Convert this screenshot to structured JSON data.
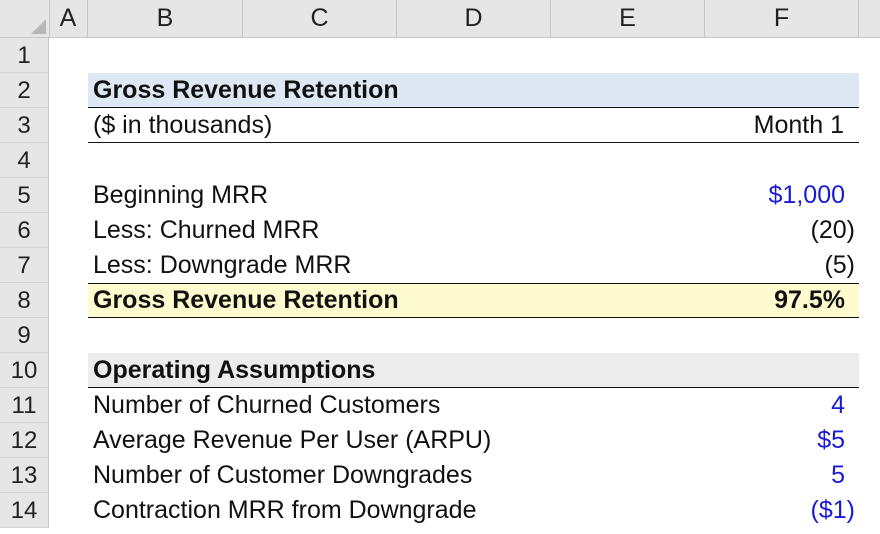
{
  "columns": [
    "A",
    "B",
    "C",
    "D",
    "E",
    "F"
  ],
  "rows": [
    "1",
    "2",
    "3",
    "4",
    "5",
    "6",
    "7",
    "8",
    "9",
    "10",
    "11",
    "12",
    "13",
    "14"
  ],
  "grr_section": {
    "title": "Gross Revenue Retention",
    "units": "($ in thousands)",
    "period": "Month 1",
    "beginning_label": "Beginning MRR",
    "beginning_value": "$1,000",
    "churned_label": "Less: Churned MRR",
    "churned_value": "(20)",
    "downgrade_label": "Less: Downgrade MRR",
    "downgrade_value": "(5)",
    "result_label": "Gross Revenue Retention",
    "result_value": "97.5%"
  },
  "assumptions": {
    "title": "Operating Assumptions",
    "churned_customers_label": "Number of Churned Customers",
    "churned_customers_value": "4",
    "arpu_label": "Average Revenue Per User (ARPU)",
    "arpu_value": "$5",
    "downgrades_label": "Number of Customer Downgrades",
    "downgrades_value": "5",
    "contraction_label": "Contraction MRR from Downgrade",
    "contraction_value": "($1)"
  },
  "colors": {
    "input_blue": "#1a1ad6",
    "header_band": "#dde8f4",
    "result_band": "#fefccf",
    "assumptions_band": "#ececec"
  }
}
